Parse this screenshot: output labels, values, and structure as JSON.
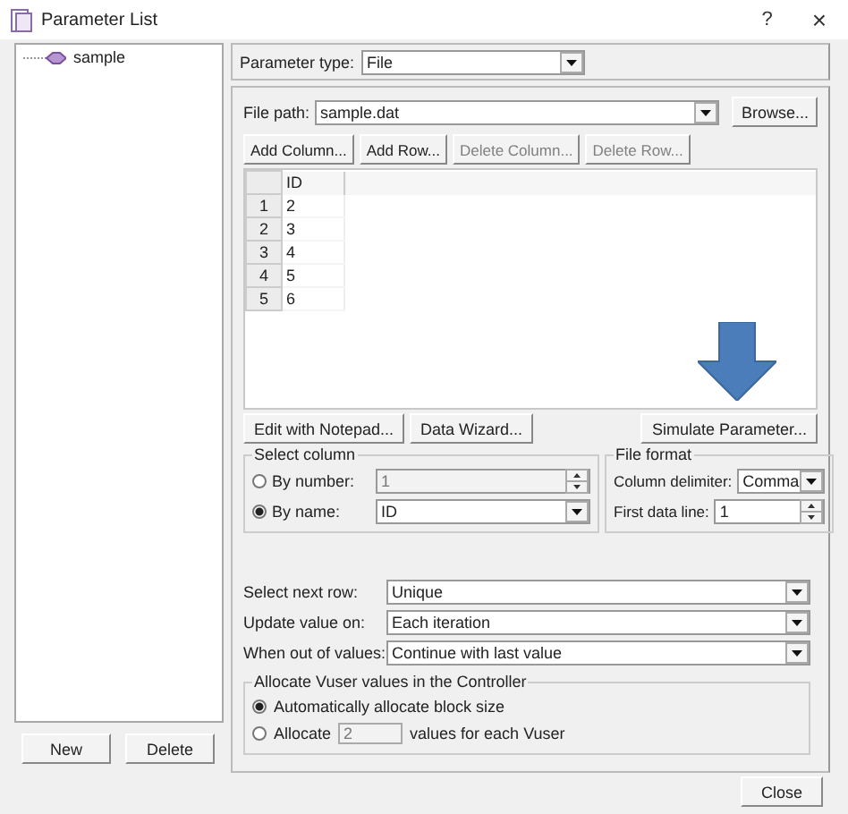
{
  "window": {
    "title": "Parameter List",
    "help": "?",
    "close": "×"
  },
  "tree": {
    "items": [
      {
        "label": "sample",
        "selected": false
      }
    ]
  },
  "tree_buttons": [
    "New",
    "Delete"
  ],
  "parameter_type": {
    "label": "Parameter type:",
    "value": "File"
  },
  "file_path": {
    "label": "File path:",
    "value": "sample.dat",
    "button": "Browse..."
  },
  "table_buttons": [
    {
      "label": "Add Column...",
      "disabled": false
    },
    {
      "label": "Add Row...",
      "disabled": false
    },
    {
      "label": "Delete Column...",
      "disabled": true
    },
    {
      "label": "Delete Row...",
      "disabled": true
    }
  ],
  "table": {
    "columns": [
      "ID"
    ],
    "rows": [
      {
        "number": "1",
        "cells": [
          "2"
        ]
      },
      {
        "number": "2",
        "cells": [
          "3"
        ]
      },
      {
        "number": "3",
        "cells": [
          "4"
        ]
      },
      {
        "number": "4",
        "cells": [
          "5"
        ]
      },
      {
        "number": "5",
        "cells": [
          "6"
        ]
      }
    ]
  },
  "actions": [
    "Edit with Notepad...",
    "Data Wizard...",
    "Simulate Parameter..."
  ],
  "select_column": {
    "title": "Select column",
    "options": [
      {
        "label": "By number:",
        "selected": false,
        "kind": "spin",
        "value": "1",
        "disabled": true
      },
      {
        "label": "By name:",
        "selected": true,
        "kind": "dropdown",
        "value": "ID",
        "disabled": false
      }
    ]
  },
  "file_format": {
    "title": "File format",
    "fields": [
      {
        "label": "Column delimiter:",
        "kind": "dropdown",
        "value": "Comma"
      },
      {
        "label": "First data line:",
        "kind": "spin",
        "value": "1"
      }
    ]
  },
  "settings": [
    {
      "label": "Select next row:",
      "value": "Unique"
    },
    {
      "label": "Update value on:",
      "value": "Each iteration"
    },
    {
      "label": "When out of values:",
      "value": "Continue with last value"
    }
  ],
  "allocate": {
    "title": "Allocate Vuser values in the Controller",
    "options": [
      {
        "kind": "plain",
        "label": "Automatically allocate block size",
        "selected": true
      },
      {
        "kind": "inline_field",
        "label": "Allocate",
        "value": "2",
        "suffix": "values for each Vuser",
        "selected": false
      }
    ]
  },
  "close_button": "Close"
}
